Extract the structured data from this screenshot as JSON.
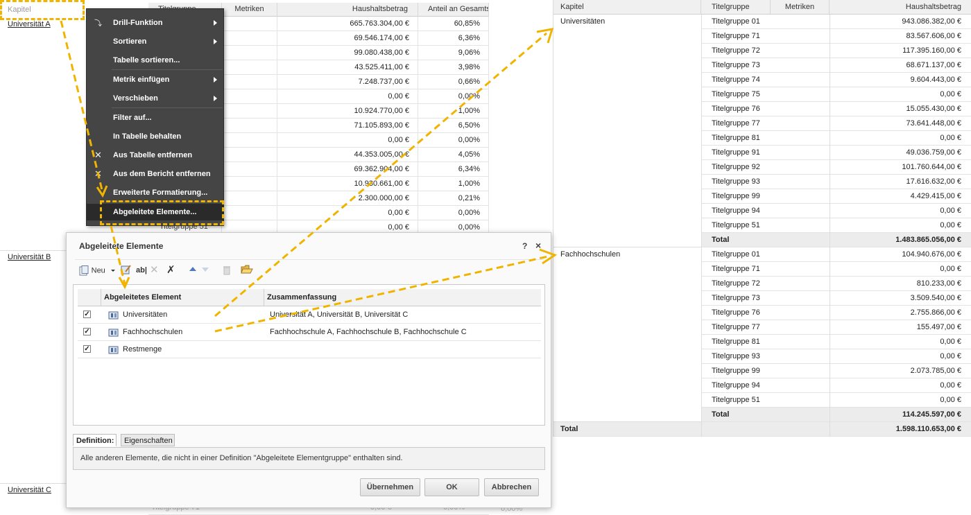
{
  "colors": {
    "highlight": "#f0b400",
    "menu_bg": "#454545",
    "total_bg": "#ececec"
  },
  "left_report": {
    "header_labels": [
      "Titelgruppe",
      "Metriken",
      "Haushaltsbetrag",
      "Anteil an Gesamts"
    ],
    "kapitel": "Kapitel",
    "row_labels": [
      "Universität A",
      "Universität B",
      "Universität C"
    ],
    "last_group_label": "Titelgruppe 51",
    "footer_group_label": "Titelgruppe 71",
    "rows": [
      {
        "betrag": "665.763.304,00 €",
        "anteil": "60,85%"
      },
      {
        "betrag": "69.546.174,00 €",
        "anteil": "6,36%"
      },
      {
        "betrag": "99.080.438,00 €",
        "anteil": "9,06%"
      },
      {
        "betrag": "43.525.411,00 €",
        "anteil": "3,98%"
      },
      {
        "betrag": "7.248.737,00 €",
        "anteil": "0,66%"
      },
      {
        "betrag": "0,00 €",
        "anteil": "0,00%"
      },
      {
        "betrag": "10.924.770,00 €",
        "anteil": "1,00%"
      },
      {
        "betrag": "71.105.893,00 €",
        "anteil": "6,50%"
      },
      {
        "betrag": "0,00 €",
        "anteil": "0,00%"
      },
      {
        "betrag": "44.353.005,00 €",
        "anteil": "4,05%"
      },
      {
        "betrag": "69.362.904,00 €",
        "anteil": "6,34%"
      },
      {
        "betrag": "10.930.661,00 €",
        "anteil": "1,00%"
      },
      {
        "betrag": "2.300.000,00 €",
        "anteil": "0,21%"
      },
      {
        "betrag": "0,00 €",
        "anteil": "0,00%"
      },
      {
        "betrag": "0,00 €",
        "anteil": "0,00%"
      }
    ],
    "footer_row": {
      "betrag": "0,00 €",
      "anteil": "0,00%",
      "extra": "0,00%"
    }
  },
  "context_menu": {
    "items": [
      {
        "label": "Drill-Funktion",
        "submenu": true,
        "icon": "drill-icon"
      },
      {
        "label": "Sortieren",
        "submenu": true
      },
      {
        "label": "Tabelle sortieren...",
        "submenu": false
      },
      {
        "label": "Metrik einfügen",
        "submenu": true
      },
      {
        "label": "Verschieben",
        "submenu": true
      },
      {
        "label": "Filter auf...",
        "submenu": false
      },
      {
        "label": "In Tabelle behalten",
        "submenu": false
      },
      {
        "label": "Aus Tabelle entfernen",
        "submenu": false,
        "icon": "remove-icon"
      },
      {
        "label": "Aus dem Bericht entfernen",
        "submenu": false,
        "icon": "remove-icon"
      },
      {
        "label": "Erweiterte Formatierung...",
        "submenu": false
      },
      {
        "label": "Abgeleitete Elemente...",
        "submenu": false,
        "active": true
      }
    ]
  },
  "dialog": {
    "title": "Abgeleitete Elemente",
    "help": "?",
    "close": "×",
    "toolbar": {
      "new_label": "Neu",
      "rename_label": "ab|"
    },
    "columns": [
      "Abgeleitetes Element",
      "Zusammenfassung"
    ],
    "rows": [
      {
        "checked": true,
        "name": "Universitäten",
        "summary": "Universität A, Universität B, Universität C"
      },
      {
        "checked": true,
        "name": "Fachhochschulen",
        "summary": "Fachhochschule A, Fachhochschule B, Fachhochschule C"
      },
      {
        "checked": true,
        "name": "Restmenge",
        "summary": ""
      }
    ],
    "tabs": [
      "Definition:",
      "Eigenschaften"
    ],
    "definition_text": "Alle anderen Elemente, die nicht in einer Definition \"Abgeleitete Elementgruppe\" enthalten sind.",
    "buttons": {
      "apply": "Übernehmen",
      "ok": "OK",
      "cancel": "Abbrechen"
    }
  },
  "right_report": {
    "headers": [
      "Kapitel",
      "Titelgruppe",
      "Metriken",
      "Haushaltsbetrag"
    ],
    "groups": [
      {
        "name": "Universitäten",
        "rows": [
          {
            "tg": "Titelgruppe 01",
            "amt": "943.086.382,00 €"
          },
          {
            "tg": "Titelgruppe 71",
            "amt": "83.567.606,00 €"
          },
          {
            "tg": "Titelgruppe 72",
            "amt": "117.395.160,00 €"
          },
          {
            "tg": "Titelgruppe 73",
            "amt": "68.671.137,00 €"
          },
          {
            "tg": "Titelgruppe 74",
            "amt": "9.604.443,00 €"
          },
          {
            "tg": "Titelgruppe 75",
            "amt": "0,00 €"
          },
          {
            "tg": "Titelgruppe 76",
            "amt": "15.055.430,00 €"
          },
          {
            "tg": "Titelgruppe 77",
            "amt": "73.641.448,00 €"
          },
          {
            "tg": "Titelgruppe 81",
            "amt": "0,00 €"
          },
          {
            "tg": "Titelgruppe 91",
            "amt": "49.036.759,00 €"
          },
          {
            "tg": "Titelgruppe 92",
            "amt": "101.760.644,00 €"
          },
          {
            "tg": "Titelgruppe 93",
            "amt": "17.616.632,00 €"
          },
          {
            "tg": "Titelgruppe 99",
            "amt": "4.429.415,00 €"
          },
          {
            "tg": "Titelgruppe 94",
            "amt": "0,00 €"
          },
          {
            "tg": "Titelgruppe 51",
            "amt": "0,00 €"
          }
        ],
        "total_label": "Total",
        "total": "1.483.865.056,00 €"
      },
      {
        "name": "Fachhochschulen",
        "rows": [
          {
            "tg": "Titelgruppe 01",
            "amt": "104.940.676,00 €"
          },
          {
            "tg": "Titelgruppe 71",
            "amt": "0,00 €"
          },
          {
            "tg": "Titelgruppe 72",
            "amt": "810.233,00 €"
          },
          {
            "tg": "Titelgruppe 73",
            "amt": "3.509.540,00 €"
          },
          {
            "tg": "Titelgruppe 76",
            "amt": "2.755.866,00 €"
          },
          {
            "tg": "Titelgruppe 77",
            "amt": "155.497,00 €"
          },
          {
            "tg": "Titelgruppe 81",
            "amt": "0,00 €"
          },
          {
            "tg": "Titelgruppe 93",
            "amt": "0,00 €"
          },
          {
            "tg": "Titelgruppe 99",
            "amt": "2.073.785,00 €"
          },
          {
            "tg": "Titelgruppe 94",
            "amt": "0,00 €"
          },
          {
            "tg": "Titelgruppe 51",
            "amt": "0,00 €"
          }
        ],
        "total_label": "Total",
        "total": "114.245.597,00 €"
      }
    ],
    "grand_total_label": "Total",
    "grand_total": "1.598.110.653,00 €"
  }
}
